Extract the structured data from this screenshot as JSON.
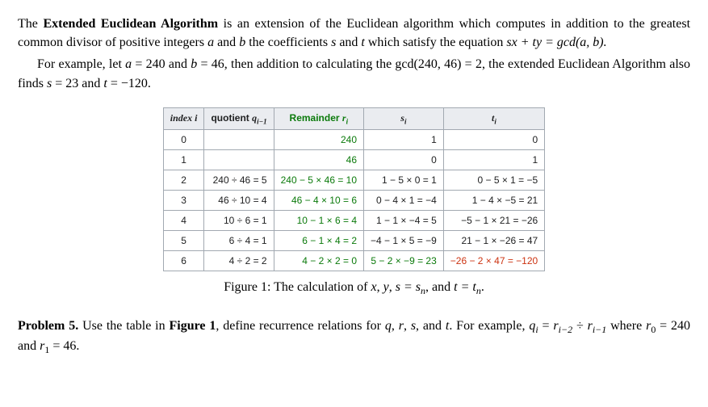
{
  "para1_a": "The ",
  "para1_b": "Extended Euclidean Algorithm",
  "para1_c": " is an extension of the Euclidean algorithm which computes in addition to the greatest common divisor of positive integers ",
  "para1_d": " and ",
  "para1_e": " the coefficients ",
  "para1_f": " and ",
  "para1_g": " which satisfy the equation ",
  "para1_eq": "sx + ty = gcd(a, b).",
  "para2_a": "For example, let ",
  "para2_b": " = 240 and ",
  "para2_c": " = 46, then addition to calculating the gcd(240, 46) = 2, the extended Euclidean Algorithm also finds ",
  "para2_d": " = 23 and ",
  "para2_e": " = −120.",
  "var_a": "a",
  "var_b": "b",
  "var_s": "s",
  "var_t": "t",
  "headers": {
    "index": "index i",
    "quotient_a": "quotient ",
    "quotient_b": "q",
    "quotient_c": "i−1",
    "remainder_a": "Remainder ",
    "remainder_b": "r",
    "remainder_c": "i",
    "s_a": "s",
    "s_b": "i",
    "t_a": "t",
    "t_b": "i"
  },
  "rows": [
    {
      "i": "0",
      "q": "",
      "r": "240",
      "s": "1",
      "t": "0"
    },
    {
      "i": "1",
      "q": "",
      "r": "46",
      "s": "0",
      "t": "1"
    },
    {
      "i": "2",
      "q": "240 ÷ 46 = 5",
      "r": "240 − 5 × 46 = 10",
      "s": "1 − 5 × 0 = 1",
      "t": "0 − 5 × 1 = −5"
    },
    {
      "i": "3",
      "q": "46 ÷ 10 = 4",
      "r": "46 − 4 × 10 = 6",
      "s": "0 − 4 × 1 = −4",
      "t": "1 − 4 × −5 = 21"
    },
    {
      "i": "4",
      "q": "10 ÷ 6 = 1",
      "r": "10 − 1 × 6 = 4",
      "s": "1 − 1 × −4 = 5",
      "t": "−5 − 1 × 21 = −26"
    },
    {
      "i": "5",
      "q": "6 ÷ 4 = 1",
      "r": "6 − 1 × 4 = 2",
      "s": "−4 − 1 × 5 = −9",
      "t": "21 − 1 × −26 = 47"
    },
    {
      "i": "6",
      "q": "4 ÷ 2 = 2",
      "r": "4 − 2 × 2 = 0",
      "s": "5 − 2 × −9 = 23",
      "t": "−26 − 2 × 47 = −120"
    }
  ],
  "caption_a": "Figure 1: The calculation of ",
  "caption_b": ", and ",
  "caption_vars": {
    "x": "x",
    "y": "y",
    "s1": "s",
    "eq1": " = s",
    "n1": "n",
    "t1": "t",
    "eq2": " = t",
    "n2": "n"
  },
  "problem_a": "Problem 5.",
  "problem_b": " Use the table in ",
  "problem_c": "Figure 1",
  "problem_d": ", define recurrence relations for ",
  "problem_e": ", and ",
  "problem_f": ". For example, ",
  "problem_g": " where ",
  "problem_h": " = 240 and ",
  "problem_i": " = 46.",
  "rec": {
    "q": "q",
    "qi": "i",
    "eq": " = ",
    "r1": "r",
    "r1i": "i−2",
    "div": " ÷ ",
    "r2": "r",
    "r2i": "i−1",
    "r0": "r",
    "r0i": "0",
    "r1l": "r",
    "r1li": "1"
  },
  "list_q": "q",
  "list_r": "r",
  "list_s": "s",
  "list_t": "t"
}
